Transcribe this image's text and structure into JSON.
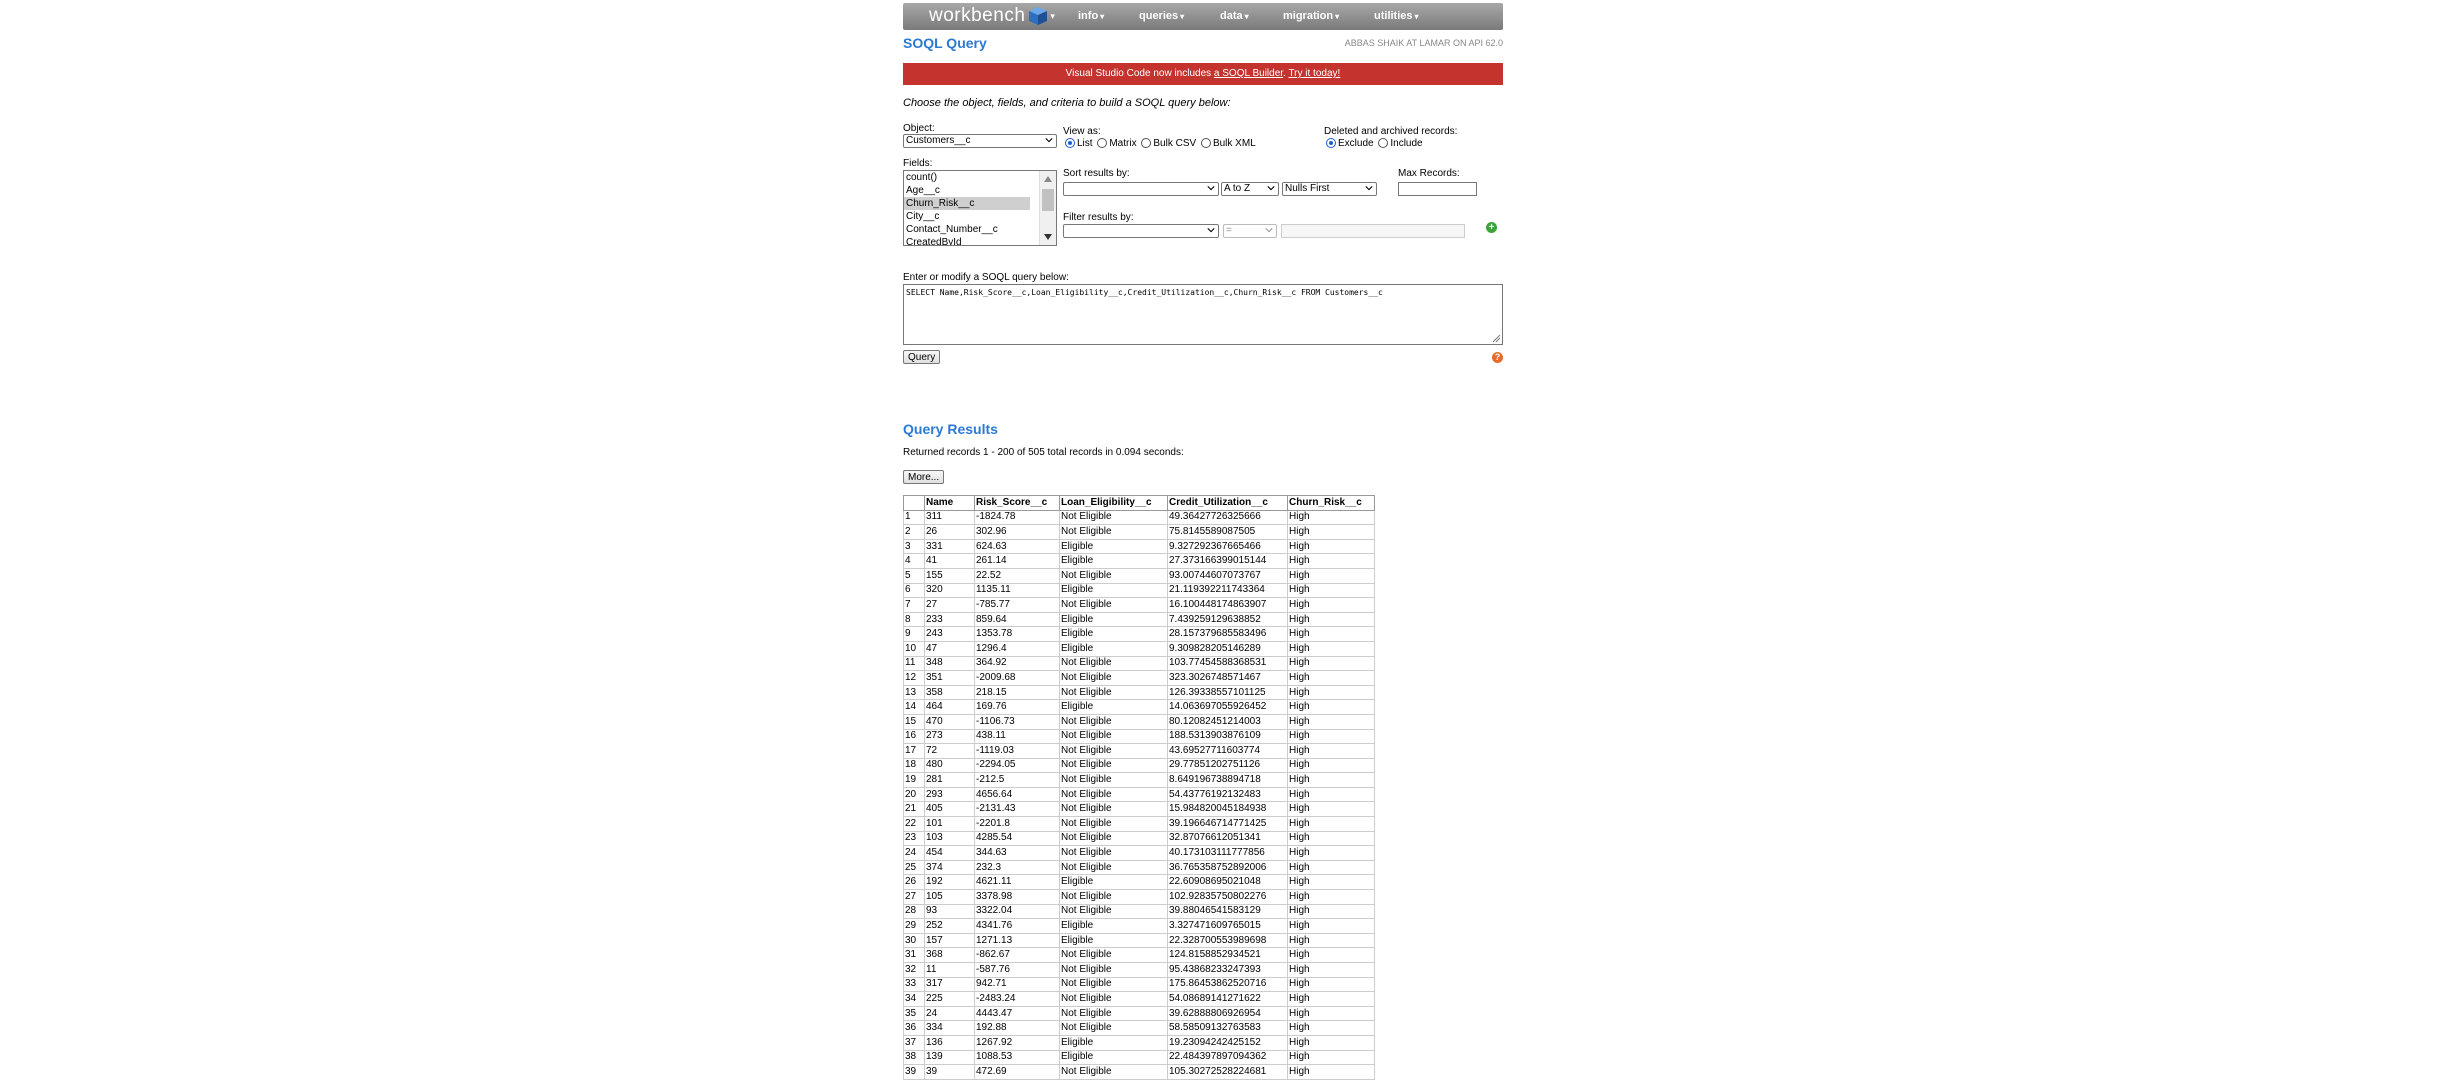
{
  "nav": {
    "brand": "workbench",
    "menus": [
      "info",
      "queries",
      "data",
      "migration",
      "utilities"
    ]
  },
  "page_title": "SOQL Query",
  "user_info": "ABBAS SHAIK AT LAMAR ON API 62.0",
  "banner": {
    "text": "Visual Studio Code now includes ",
    "link1": "a SOQL Builder",
    "sep": ". ",
    "link2": "Try it today!"
  },
  "instructions": "Choose the object, fields, and criteria to build a SOQL query below:",
  "object": {
    "label": "Object:",
    "value": "Customers__c"
  },
  "view_as": {
    "label": "View as:",
    "options": [
      "List",
      "Matrix",
      "Bulk CSV",
      "Bulk XML"
    ],
    "selected": "List"
  },
  "deleted": {
    "label": "Deleted and archived records:",
    "options": [
      "Exclude",
      "Include"
    ],
    "selected": "Exclude"
  },
  "fields": {
    "label": "Fields:",
    "options": [
      "count()",
      "Age__c",
      "Churn_Risk__c",
      "City__c",
      "Contact_Number__c",
      "CreatedById"
    ],
    "selected": "Churn_Risk__c"
  },
  "sort": {
    "label": "Sort results by:",
    "field_value": "",
    "direction": "A to Z",
    "nulls": "Nulls First"
  },
  "max_records": {
    "label": "Max Records:",
    "value": ""
  },
  "filter": {
    "label": "Filter results by:",
    "field_value": "",
    "operator": "=",
    "value": ""
  },
  "query_box": {
    "label": "Enter or modify a SOQL query below:",
    "value": "SELECT Name,Risk_Score__c,Loan_Eligibility__c,Credit_Utilization__c,Churn_Risk__c FROM Customers__c"
  },
  "query_button": "Query",
  "results": {
    "title": "Query Results",
    "summary": "Returned records 1 - 200 of 505 total records in 0.094 seconds:",
    "more_button": "More...",
    "columns": [
      "",
      "Name",
      "Risk_Score__c",
      "Loan_Eligibility__c",
      "Credit_Utilization__c",
      "Churn_Risk__c"
    ],
    "rows": [
      [
        "1",
        "311",
        "-1824.78",
        "Not Eligible",
        "49.36427726325666",
        "High"
      ],
      [
        "2",
        "26",
        "302.96",
        "Not Eligible",
        "75.8145589087505",
        "High"
      ],
      [
        "3",
        "331",
        "624.63",
        "Eligible",
        "9.327292367665466",
        "High"
      ],
      [
        "4",
        "41",
        "261.14",
        "Eligible",
        "27.373166399015144",
        "High"
      ],
      [
        "5",
        "155",
        "22.52",
        "Not Eligible",
        "93.00744607073767",
        "High"
      ],
      [
        "6",
        "320",
        "1135.11",
        "Eligible",
        "21.119392211743364",
        "High"
      ],
      [
        "7",
        "27",
        "-785.77",
        "Not Eligible",
        "16.100448174863907",
        "High"
      ],
      [
        "8",
        "233",
        "859.64",
        "Eligible",
        "7.439259129638852",
        "High"
      ],
      [
        "9",
        "243",
        "1353.78",
        "Eligible",
        "28.157379685583496",
        "High"
      ],
      [
        "10",
        "47",
        "1296.4",
        "Eligible",
        "9.309828205146289",
        "High"
      ],
      [
        "11",
        "348",
        "364.92",
        "Not Eligible",
        "103.77454588368531",
        "High"
      ],
      [
        "12",
        "351",
        "-2009.68",
        "Not Eligible",
        "323.3026748571467",
        "High"
      ],
      [
        "13",
        "358",
        "218.15",
        "Not Eligible",
        "126.39338557101125",
        "High"
      ],
      [
        "14",
        "464",
        "169.76",
        "Eligible",
        "14.063697055926452",
        "High"
      ],
      [
        "15",
        "470",
        "-1106.73",
        "Not Eligible",
        "80.12082451214003",
        "High"
      ],
      [
        "16",
        "273",
        "438.11",
        "Not Eligible",
        "188.5313903876109",
        "High"
      ],
      [
        "17",
        "72",
        "-1119.03",
        "Not Eligible",
        "43.69527711603774",
        "High"
      ],
      [
        "18",
        "480",
        "-2294.05",
        "Not Eligible",
        "29.77851202751126",
        "High"
      ],
      [
        "19",
        "281",
        "-212.5",
        "Not Eligible",
        "8.649196738894718",
        "High"
      ],
      [
        "20",
        "293",
        "4656.64",
        "Not Eligible",
        "54.43776192132483",
        "High"
      ],
      [
        "21",
        "405",
        "-2131.43",
        "Not Eligible",
        "15.984820045184938",
        "High"
      ],
      [
        "22",
        "101",
        "-2201.8",
        "Not Eligible",
        "39.196646714771425",
        "High"
      ],
      [
        "23",
        "103",
        "4285.54",
        "Not Eligible",
        "32.87076612051341",
        "High"
      ],
      [
        "24",
        "454",
        "344.63",
        "Not Eligible",
        "40.173103111777856",
        "High"
      ],
      [
        "25",
        "374",
        "232.3",
        "Not Eligible",
        "36.765358752892006",
        "High"
      ],
      [
        "26",
        "192",
        "4621.11",
        "Eligible",
        "22.60908695021048",
        "High"
      ],
      [
        "27",
        "105",
        "3378.98",
        "Not Eligible",
        "102.92835750802276",
        "High"
      ],
      [
        "28",
        "93",
        "3322.04",
        "Not Eligible",
        "39.88046541583129",
        "High"
      ],
      [
        "29",
        "252",
        "4341.76",
        "Eligible",
        "3.327471609765015",
        "High"
      ],
      [
        "30",
        "157",
        "1271.13",
        "Eligible",
        "22.328700553989698",
        "High"
      ],
      [
        "31",
        "368",
        "-862.67",
        "Not Eligible",
        "124.8158852934521",
        "High"
      ],
      [
        "32",
        "11",
        "-587.76",
        "Not Eligible",
        "95.43868233247393",
        "High"
      ],
      [
        "33",
        "317",
        "942.71",
        "Not Eligible",
        "175.86453862520716",
        "High"
      ],
      [
        "34",
        "225",
        "-2483.24",
        "Not Eligible",
        "54.08689141271622",
        "High"
      ],
      [
        "35",
        "24",
        "4443.47",
        "Not Eligible",
        "39.62888806926954",
        "High"
      ],
      [
        "36",
        "334",
        "192.88",
        "Not Eligible",
        "58.58509132763583",
        "High"
      ],
      [
        "37",
        "136",
        "1267.92",
        "Eligible",
        "19.23094242425152",
        "High"
      ],
      [
        "38",
        "139",
        "1088.53",
        "Eligible",
        "22.484397897094362",
        "High"
      ],
      [
        "39",
        "39",
        "472.69",
        "Not Eligible",
        "105.30272528224681",
        "High"
      ]
    ]
  }
}
